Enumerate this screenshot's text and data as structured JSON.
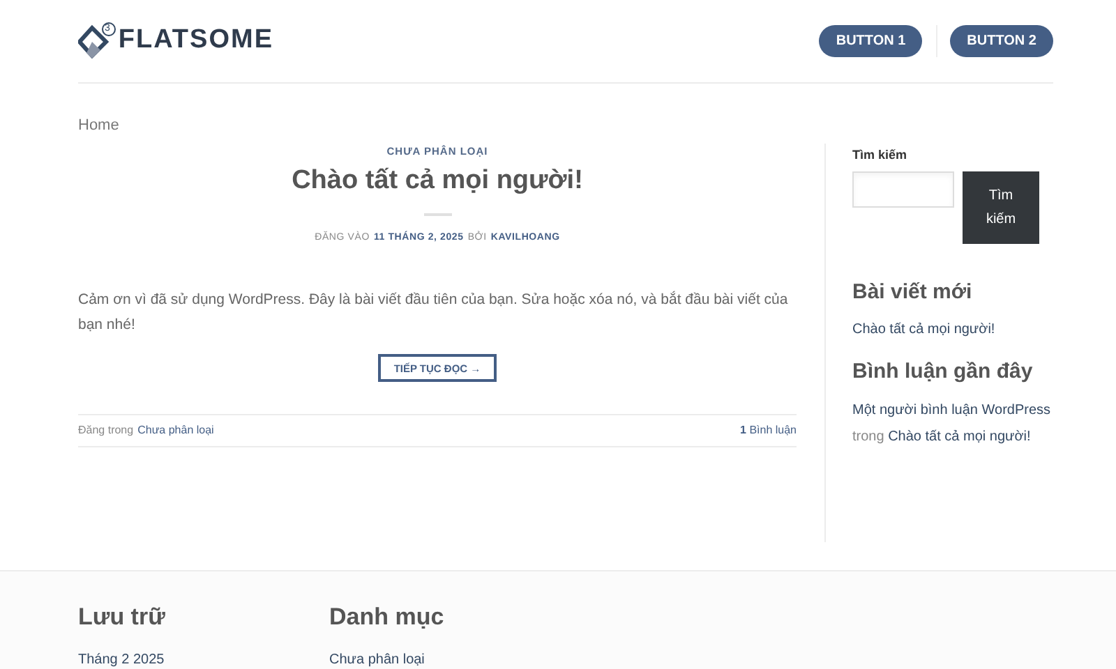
{
  "header": {
    "logo": "FLATSOME",
    "logo_badge": "3",
    "buttons": [
      "BUTTON 1",
      "BUTTON 2"
    ]
  },
  "breadcrumb": "Home",
  "post": {
    "category": "CHƯA PHÂN LOẠI",
    "title": "Chào tất cả mọi người!",
    "meta_prefix": "ĐĂNG VÀO",
    "date": "11 THÁNG 2, 2025",
    "meta_by": "BỞI",
    "author": "KAVILHOANG",
    "excerpt": "Cảm ơn vì đã sử dụng WordPress. Đây là bài viết đầu tiên của bạn. Sửa hoặc xóa nó, và bắt đầu bài viết của bạn nhé!",
    "read_more": "TIẾP TỤC ĐỌC →",
    "posted_in_label": "Đăng trong",
    "posted_in": "Chưa phân loại",
    "comments_count": "1",
    "comments_label": "Bình luận"
  },
  "sidebar": {
    "search_title": "Tìm kiếm",
    "search_button": "Tìm kiếm",
    "recent_posts_title": "Bài viết mới",
    "recent_posts": [
      "Chào tất cả mọi người!"
    ],
    "recent_comments_title": "Bình luận gần đây",
    "recent_comment": {
      "author": "Một người bình luận WordPress",
      "on": "trong",
      "post": "Chào tất cả mọi người!"
    }
  },
  "footer": {
    "columns": [
      {
        "title": "Lưu trữ",
        "items": [
          "Tháng 2 2025"
        ]
      },
      {
        "title": "Danh mục",
        "items": [
          "Chưa phân loại"
        ]
      }
    ]
  }
}
